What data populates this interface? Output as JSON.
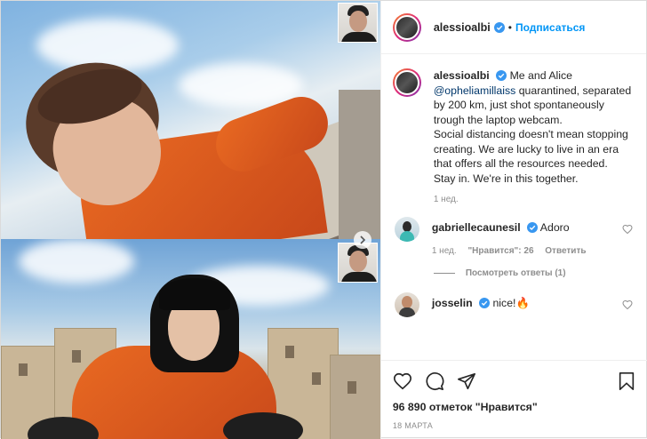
{
  "post": {
    "username": "alessioalbi",
    "follow_label": "Подписаться",
    "separator": "•",
    "caption": {
      "username": "alessioalbi",
      "lead": "Me and Alice",
      "mention": "@opheliamillaiss",
      "line1_rest": "quarantined, separated by 200 km, just shot spontaneously trough the laptop webcam.",
      "para2": "Social distancing doesn't mean stopping creating. We are lucky to live in an era that offers all the resources needed.",
      "para3": "Stay in. We're in this together.",
      "time": "1 нед."
    },
    "comments": [
      {
        "username": "gabriellecaunesil",
        "text": "Adoro",
        "time": "1 нед.",
        "likes": "\"Нравится\": 26",
        "reply_label": "Ответить",
        "view_replies": "Посмотреть ответы (1)"
      },
      {
        "username": "josselin",
        "text": "nice!🔥"
      }
    ],
    "likes_text": "96 890 отметок \"Нравится\"",
    "date": "18 МАРТА"
  },
  "icons": {
    "verified": "verified-badge-icon",
    "heart": "heart-icon",
    "comment": "comment-icon",
    "share": "share-icon",
    "bookmark": "bookmark-icon",
    "next": "chevron-right-icon"
  },
  "colors": {
    "accent": "#0095f6",
    "verified": "#3897f0",
    "muted": "#8e8e8e",
    "text": "#262626"
  }
}
